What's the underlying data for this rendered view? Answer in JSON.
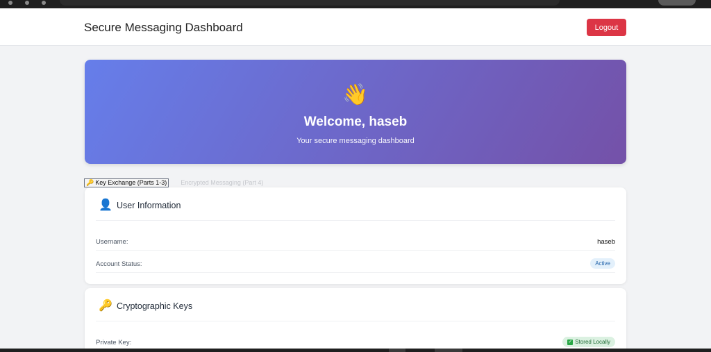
{
  "header": {
    "title": "Secure Messaging Dashboard",
    "logout_label": "Logout"
  },
  "hero": {
    "emoji": "👋",
    "welcome": "Welcome, haseb",
    "subtitle": "Your secure messaging dashboard"
  },
  "tabs": [
    {
      "icon": "🔑",
      "label": "Key Exchange (Parts 1-3)",
      "active": true
    },
    {
      "label": "Encrypted Messaging (Part 4)",
      "active": false
    }
  ],
  "user_info": {
    "icon": "👤",
    "title": "User Information",
    "rows": [
      {
        "label": "Username:",
        "value": "haseb"
      },
      {
        "label": "Account Status:",
        "badge": "Active"
      }
    ]
  },
  "crypto_keys": {
    "icon": "🔑",
    "title": "Cryptographic Keys",
    "rows": [
      {
        "label": "Private Key:",
        "badge_icon": "✓",
        "badge": "Stored Locally"
      }
    ]
  },
  "colors": {
    "logout": "#dc3545",
    "hero_start": "#667eea",
    "hero_end": "#7451a8",
    "active_badge": "#e3f0fb",
    "stored_badge": "#dbf1e1"
  }
}
